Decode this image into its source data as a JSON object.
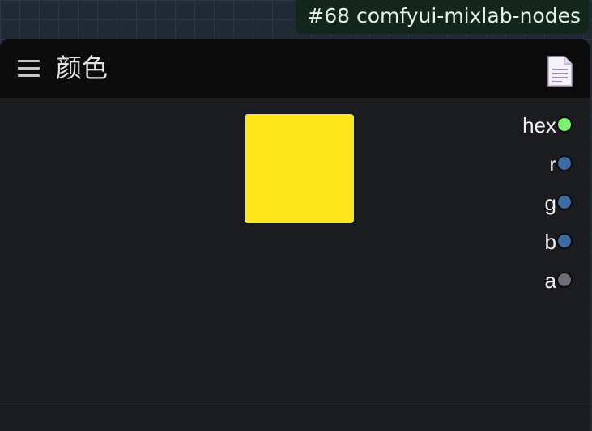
{
  "badge": {
    "text": "#68 comfyui-mixlab-nodes"
  },
  "node": {
    "title": "颜色",
    "menu_icon": "menu-icon",
    "doc_icon": "document-icon",
    "swatch_color": "#fce61c",
    "outputs": [
      {
        "label": "hex",
        "color": "#7bf275"
      },
      {
        "label": "r",
        "color": "#3d6aa0"
      },
      {
        "label": "g",
        "color": "#3d6aa0"
      },
      {
        "label": "b",
        "color": "#3d6aa0"
      },
      {
        "label": "a",
        "color": "#6c6b7a"
      }
    ]
  }
}
